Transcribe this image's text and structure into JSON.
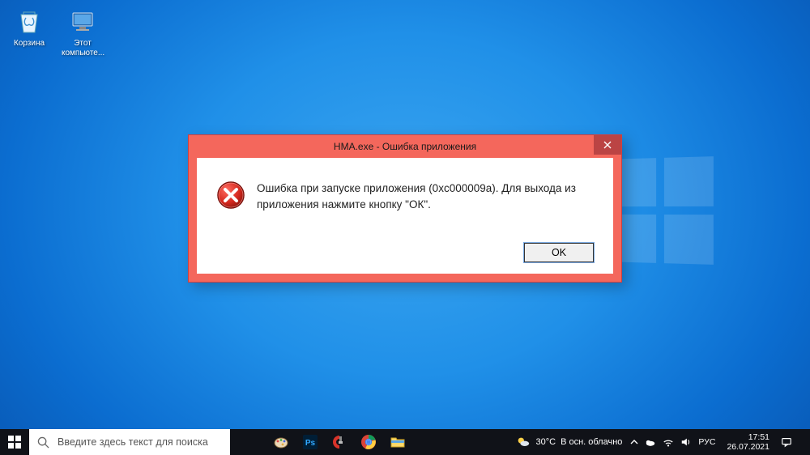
{
  "desktop": {
    "icons": [
      {
        "name": "recycle-bin",
        "label": "Корзина"
      },
      {
        "name": "this-pc",
        "label": "Этот компьюте..."
      }
    ]
  },
  "dialog": {
    "title": "HMA.exe - Ошибка приложения",
    "message": "Ошибка при запуске приложения (0xc000009a). Для выхода из приложения нажмите кнопку \"ОК\".",
    "ok_label": "OK"
  },
  "taskbar": {
    "search_placeholder": "Введите здесь текст для поиска",
    "weather_temp": "30°C",
    "weather_text": "В осн. облачно",
    "lang": "РУС",
    "time": "17:51",
    "date": "26.07.2021"
  }
}
